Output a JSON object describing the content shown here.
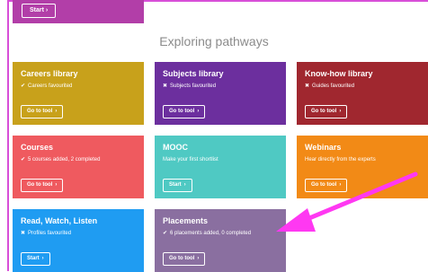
{
  "top": {
    "start_label": "Start"
  },
  "section": {
    "title": "Exploring pathways"
  },
  "cards": [
    {
      "title": "Careers library",
      "status_icon": "check",
      "status": "Careers favourited",
      "button": "Go to tool",
      "color": "#c8a11b"
    },
    {
      "title": "Subjects library",
      "status_icon": "cross",
      "status": "Subjects favourited",
      "button": "Go to tool",
      "color": "#6c2f9e"
    },
    {
      "title": "Know-how library",
      "status_icon": "cross",
      "status": "Guides favourited",
      "button": "Go to tool",
      "color": "#a0272f"
    },
    {
      "title": "Courses",
      "status_icon": "check",
      "status": "5 courses added, 2 completed",
      "button": "Go to tool",
      "color": "#ef5a5f"
    },
    {
      "title": "MOOC",
      "status_icon": "",
      "status": "Make your first shortlist",
      "button": "Start",
      "color": "#4fc9c3"
    },
    {
      "title": "Webinars",
      "status_icon": "",
      "status": "Hear directly from the experts",
      "button": "Go to tool",
      "color": "#f28a16"
    },
    {
      "title": "Read, Watch, Listen",
      "status_icon": "cross",
      "status": "Profiles favourited",
      "button": "Start",
      "color": "#1f9cf2"
    },
    {
      "title": "Placements",
      "status_icon": "check",
      "status": "6 placements added, 0 completed",
      "button": "Go to tool",
      "color": "#8a6fa0"
    }
  ],
  "glyphs": {
    "check": "✔",
    "cross": "✖",
    "chevron": "›"
  },
  "colors": {
    "frame": "#d84fd8",
    "arrow": "#ff38f2",
    "title": "#8b8b8b"
  }
}
